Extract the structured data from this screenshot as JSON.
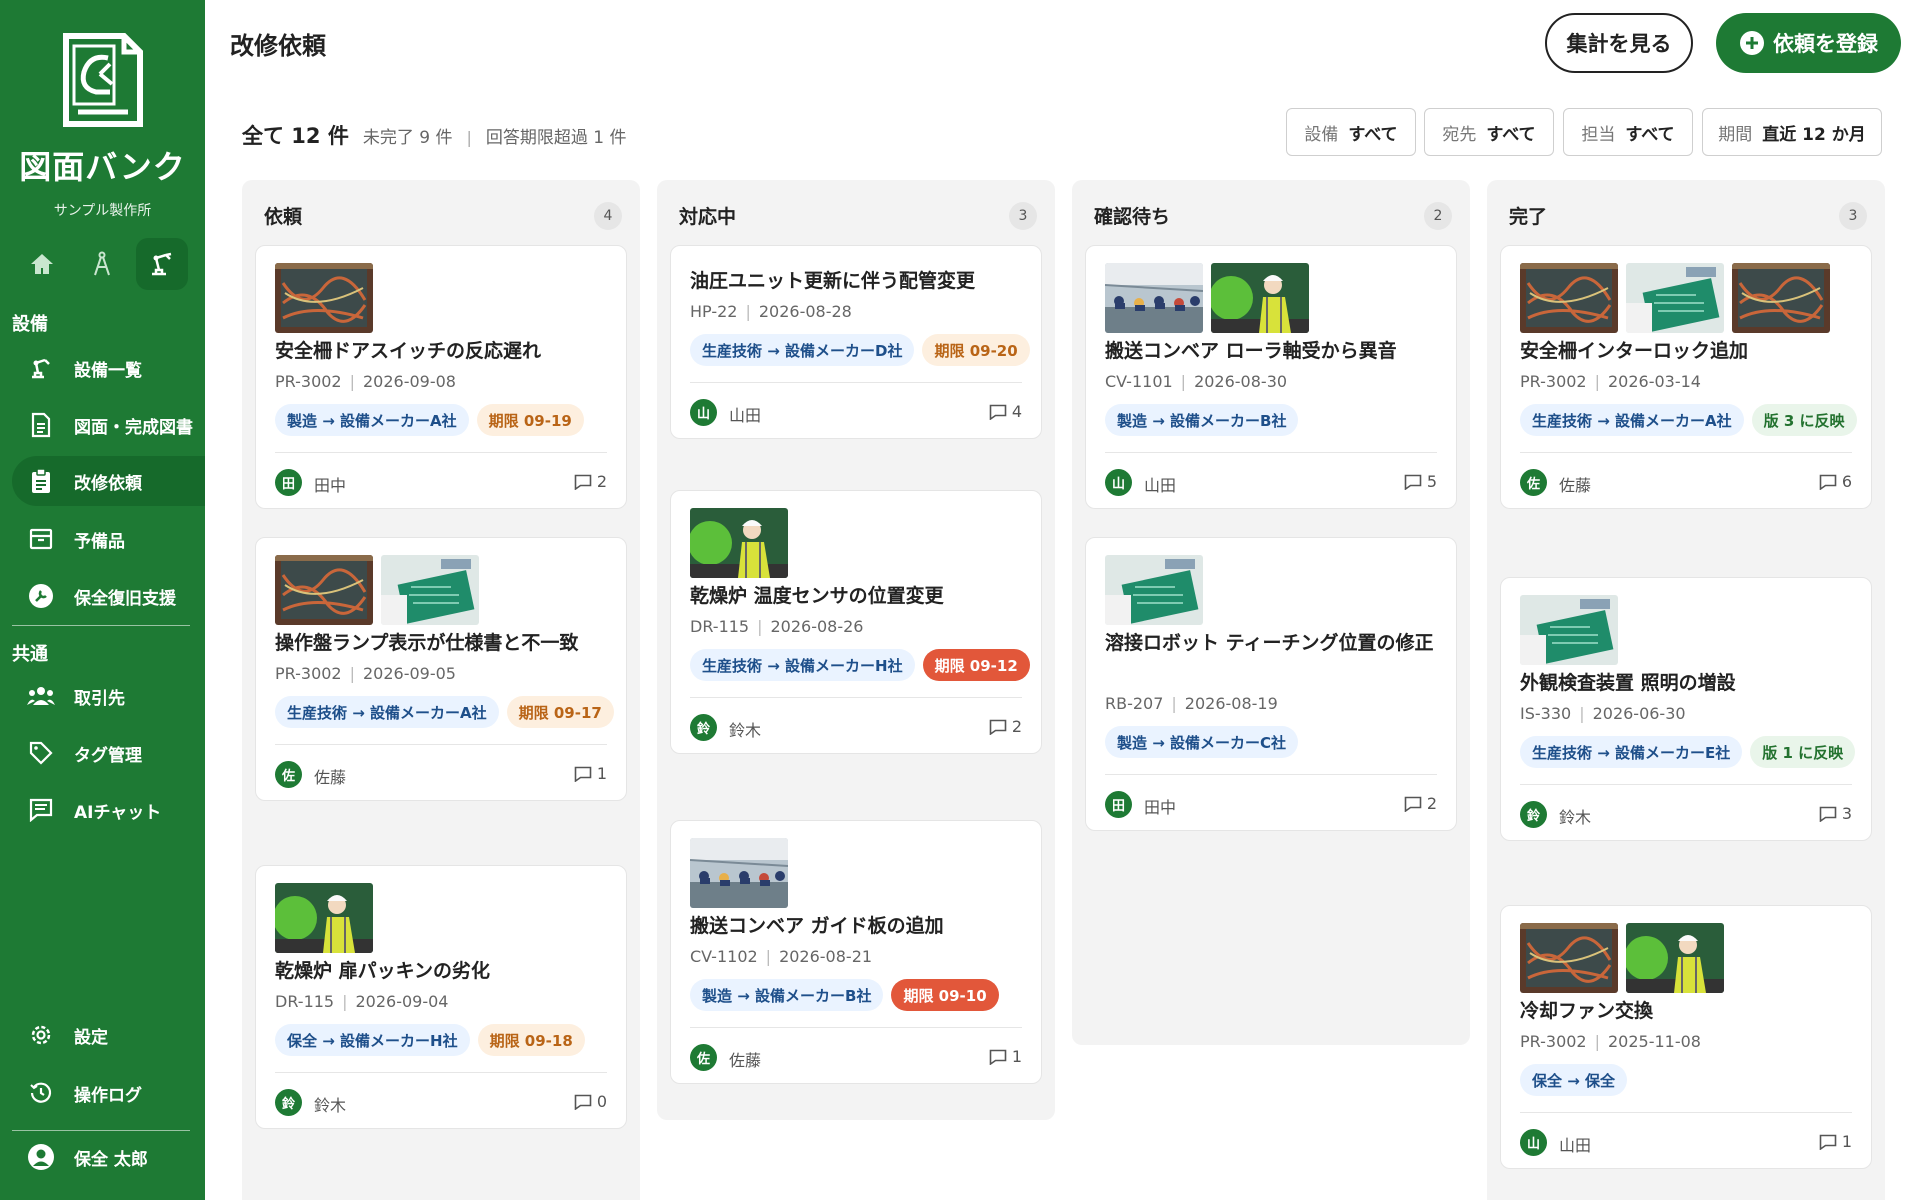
{
  "app": {
    "brand": "図面バンク",
    "org": "サンプル製作所"
  },
  "sidebar": {
    "sections": {
      "equipment": "設備",
      "common": "共通"
    },
    "items": [
      {
        "label": "設備一覧",
        "icon": "equipment-icon"
      },
      {
        "label": "図面・完成図書",
        "icon": "document-icon"
      },
      {
        "label": "改修依頼",
        "icon": "clipboard-icon"
      },
      {
        "label": "予備品",
        "icon": "archive-icon"
      },
      {
        "label": "保全復旧支援",
        "icon": "wrench-icon"
      },
      {
        "label": "取引先",
        "icon": "people-icon"
      },
      {
        "label": "タグ管理",
        "icon": "tag-icon"
      },
      {
        "label": "AIチャット",
        "icon": "chat-icon"
      },
      {
        "label": "設定",
        "icon": "gear-icon"
      },
      {
        "label": "操作ログ",
        "icon": "history-icon"
      }
    ],
    "user": "保全 太郎"
  },
  "header": {
    "title": "改修依頼",
    "stats_button": "集計を見る",
    "register_button": "依頼を登録"
  },
  "summary": {
    "total": "全て 12 件",
    "incomplete": "未完了 9 件",
    "overdue": "回答期限超過 1 件"
  },
  "filters": [
    {
      "label": "設備",
      "value": "すべて"
    },
    {
      "label": "宛先",
      "value": "すべて"
    },
    {
      "label": "担当",
      "value": "すべて"
    },
    {
      "label": "期間",
      "value": "直近 12 か月"
    }
  ],
  "columns": [
    {
      "title": "依頼",
      "count": "4",
      "cards": [
        {
          "title": "安全柵ドアスイッチの反応遅れ",
          "id": "PR-3002",
          "date": "2026-09-08",
          "tags": [
            {
              "text": "製造 → 設備メーカーA社",
              "kind": "blue"
            },
            {
              "text": "期限 09-19",
              "kind": "orange"
            }
          ],
          "avatar": "田",
          "person": "田中",
          "comments": "2"
        },
        {
          "title": "操作盤ランプ表示が仕様書と不一致",
          "id": "PR-3002",
          "date": "2026-09-05",
          "tags": [
            {
              "text": "生産技術 → 設備メーカーA社",
              "kind": "blue"
            },
            {
              "text": "期限 09-17",
              "kind": "orange"
            }
          ],
          "avatar": "佐",
          "person": "佐藤",
          "comments": "1"
        },
        {
          "title": "乾燥炉 扉パッキンの劣化",
          "id": "DR-115",
          "date": "2026-09-04",
          "tags": [
            {
              "text": "保全 → 設備メーカーH社",
              "kind": "blue"
            },
            {
              "text": "期限 09-18",
              "kind": "orange"
            }
          ],
          "avatar": "鈴",
          "person": "鈴木",
          "comments": "0"
        }
      ]
    },
    {
      "title": "対応中",
      "count": "3",
      "cards": [
        {
          "title": "油圧ユニット更新に伴う配管変更",
          "id": "HP-22",
          "date": "2026-08-28",
          "tags": [
            {
              "text": "生産技術 → 設備メーカーD社",
              "kind": "blue"
            },
            {
              "text": "期限 09-20",
              "kind": "orange"
            }
          ],
          "avatar": "山",
          "person": "山田",
          "comments": "4"
        },
        {
          "title": "乾燥炉 温度センサの位置変更",
          "id": "DR-115",
          "date": "2026-08-26",
          "tags": [
            {
              "text": "生産技術 → 設備メーカーH社",
              "kind": "blue"
            },
            {
              "text": "期限 09-12",
              "kind": "red"
            }
          ],
          "avatar": "鈴",
          "person": "鈴木",
          "comments": "2"
        },
        {
          "title": "搬送コンベア ガイド板の追加",
          "id": "CV-1102",
          "date": "2026-08-21",
          "tags": [
            {
              "text": "製造 → 設備メーカーB社",
              "kind": "blue"
            },
            {
              "text": "期限 09-10",
              "kind": "red"
            }
          ],
          "avatar": "佐",
          "person": "佐藤",
          "comments": "1"
        }
      ]
    },
    {
      "title": "確認待ち",
      "count": "2",
      "cards": [
        {
          "title": "搬送コンベア ローラ軸受から異音",
          "id": "CV-1101",
          "date": "2026-08-30",
          "tags": [
            {
              "text": "製造 → 設備メーカーB社",
              "kind": "blue"
            }
          ],
          "avatar": "山",
          "person": "山田",
          "comments": "5"
        },
        {
          "title": "溶接ロボット ティーチング位置の修正",
          "id": "RB-207",
          "date": "2026-08-19",
          "tags": [
            {
              "text": "製造 → 設備メーカーC社",
              "kind": "blue"
            }
          ],
          "avatar": "田",
          "person": "田中",
          "comments": "2"
        }
      ]
    },
    {
      "title": "完了",
      "count": "3",
      "cards": [
        {
          "title": "安全柵インターロック追加",
          "id": "PR-3002",
          "date": "2026-03-14",
          "tags": [
            {
              "text": "生産技術 → 設備メーカーA社",
              "kind": "blue"
            },
            {
              "text": "版 3 に反映",
              "kind": "green"
            }
          ],
          "avatar": "佐",
          "person": "佐藤",
          "comments": "6"
        },
        {
          "title": "外観検査装置 照明の増設",
          "id": "IS-330",
          "date": "2026-06-30",
          "tags": [
            {
              "text": "生産技術 → 設備メーカーE社",
              "kind": "blue"
            },
            {
              "text": "版 1 に反映",
              "kind": "green"
            }
          ],
          "avatar": "鈴",
          "person": "鈴木",
          "comments": "3"
        },
        {
          "title": "冷却ファン交換",
          "id": "PR-3002",
          "date": "2025-11-08",
          "tags": [
            {
              "text": "保全 → 保全",
              "kind": "blue"
            }
          ],
          "avatar": "山",
          "person": "山田",
          "comments": "1"
        }
      ]
    }
  ]
}
